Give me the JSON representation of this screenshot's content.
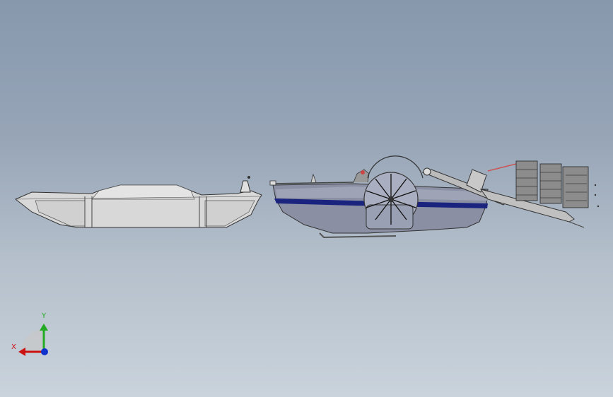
{
  "viewport": {
    "background_top": "#8798ad",
    "background_bottom": "#cad3dc"
  },
  "models": {
    "left_hull": {
      "color": "#d9d9d9",
      "outline": "#333333"
    },
    "right_boat": {
      "hull_color": "#8a8fa3",
      "stripe_color": "#1a237e",
      "paddle_wheel": "paddle-wheel",
      "conveyor": "conveyor-frame"
    }
  },
  "triad": {
    "y_label": "Y",
    "x_label": "X",
    "y_color": "#22aa22",
    "x_color": "#cc1111",
    "z_color": "#1133cc"
  }
}
